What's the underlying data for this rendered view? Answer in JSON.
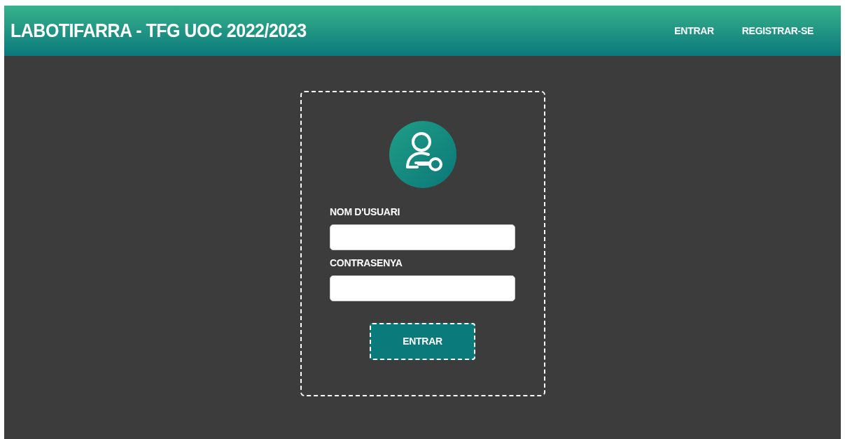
{
  "header": {
    "title": "LABOTIFARRA - TFG UOC 2022/2023",
    "nav": [
      "ENTRAR",
      "REGISTRAR-SE"
    ]
  },
  "login_form": {
    "fields": [
      {
        "label": "NOM D'USUARI"
      },
      {
        "label": "CONTRASENYA"
      }
    ],
    "submit": "ENTRAR"
  }
}
